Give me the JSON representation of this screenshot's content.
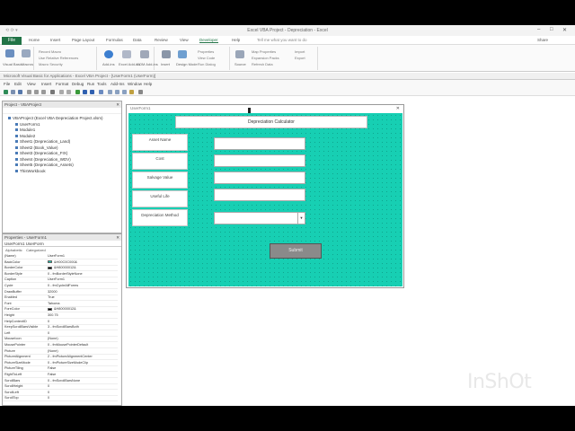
{
  "excel": {
    "title": "Excel VBA Project - Depreciation - Excel",
    "quick_access": "⟲ ⟳ ▾",
    "tabs": [
      {
        "label": "Home"
      },
      {
        "label": "Insert"
      },
      {
        "label": "Page Layout"
      },
      {
        "label": "Formulas"
      },
      {
        "label": "Data"
      },
      {
        "label": "Review"
      },
      {
        "label": "View"
      },
      {
        "label": "Developer"
      },
      {
        "label": "Help"
      }
    ],
    "file_tab": "File",
    "active_tab": "Developer",
    "search_placeholder": "Tell me what you want to do",
    "share": "Share",
    "ribbon": {
      "code": [
        "Visual Basic",
        "Macros"
      ],
      "record": [
        "Record Macro",
        "Use Relative References",
        "Macro Security"
      ],
      "addins": [
        "Add-ins",
        "Excel Add-ins",
        "COM Add-ins"
      ],
      "controls": [
        "Insert",
        "Design Mode",
        "Properties",
        "View Code",
        "Run Dialog"
      ],
      "xml": [
        "Source",
        "Map Properties",
        "Expansion Packs",
        "Refresh Data",
        "Import",
        "Export"
      ]
    }
  },
  "vbe": {
    "title": "Microsoft Visual Basic for Applications - Excel VBA Project - [UserForm1 (UserForm)]",
    "menu": [
      "File",
      "Edit",
      "View",
      "Insert",
      "Format",
      "Debug",
      "Run",
      "Tools",
      "Add-Ins",
      "Window",
      "Help"
    ]
  },
  "project": {
    "title": "Project - VBAProject",
    "items": [
      "VBAProject (Excel VBA Depreciation Project.xlsm)",
      "UserForm1",
      "Module1",
      "Module2",
      "Sheet1 (Depreciation_Land)",
      "Sheet2 (Book_Value)",
      "Sheet3 (Depreciation_FIX)",
      "Sheet4 (Depreciation_WDV)",
      "Sheet5 (Depreciation_Assets)",
      "ThisWorkbook"
    ]
  },
  "properties": {
    "title": "Properties - UserForm1",
    "object": "UserForm1  UserForm",
    "tabs": [
      "Alphabetic",
      "Categorized"
    ],
    "rows": [
      {
        "key": "(Name)",
        "value": "UserForm1"
      },
      {
        "key": "BackColor",
        "value": "&H00C0C000&",
        "swatch": "#17cfb3"
      },
      {
        "key": "BorderColor",
        "value": "&H80000012&",
        "swatch": "#000000"
      },
      {
        "key": "BorderStyle",
        "value": "0 - fmBorderStyleNone"
      },
      {
        "key": "Caption",
        "value": "UserForm1"
      },
      {
        "key": "Cycle",
        "value": "0 - fmCycleAllForms"
      },
      {
        "key": "DrawBuffer",
        "value": "32000"
      },
      {
        "key": "Enabled",
        "value": "True"
      },
      {
        "key": "Font",
        "value": "Tahoma"
      },
      {
        "key": "ForeColor",
        "value": "&H80000012&",
        "swatch": "#000000"
      },
      {
        "key": "Height",
        "value": "300.75"
      },
      {
        "key": "HelpContextID",
        "value": "0"
      },
      {
        "key": "KeepScrollBarsVisible",
        "value": "3 - fmScrollBarsBoth"
      },
      {
        "key": "Left",
        "value": "0"
      },
      {
        "key": "MouseIcon",
        "value": "(None)"
      },
      {
        "key": "MousePointer",
        "value": "0 - fmMousePointerDefault"
      },
      {
        "key": "Picture",
        "value": "(None)"
      },
      {
        "key": "PictureAlignment",
        "value": "2 - fmPictureAlignmentCenter"
      },
      {
        "key": "PictureSizeMode",
        "value": "0 - fmPictureSizeModeClip"
      },
      {
        "key": "PictureTiling",
        "value": "False"
      },
      {
        "key": "RightToLeft",
        "value": "False"
      },
      {
        "key": "ScrollBars",
        "value": "0 - fmScrollBarsNone"
      },
      {
        "key": "ScrollHeight",
        "value": "0"
      },
      {
        "key": "ScrollLeft",
        "value": "0"
      },
      {
        "key": "ScrollTop",
        "value": "0"
      }
    ]
  },
  "userform": {
    "caption": "UserForm1",
    "heading": "Depreciation Calculator",
    "labels": [
      "Asset Name",
      "Cost",
      "Salvage Value",
      "Useful Life",
      "Depreciation Method"
    ],
    "submit": "Submit",
    "back_color": "#17cfb3"
  },
  "watermark": "InShOt"
}
